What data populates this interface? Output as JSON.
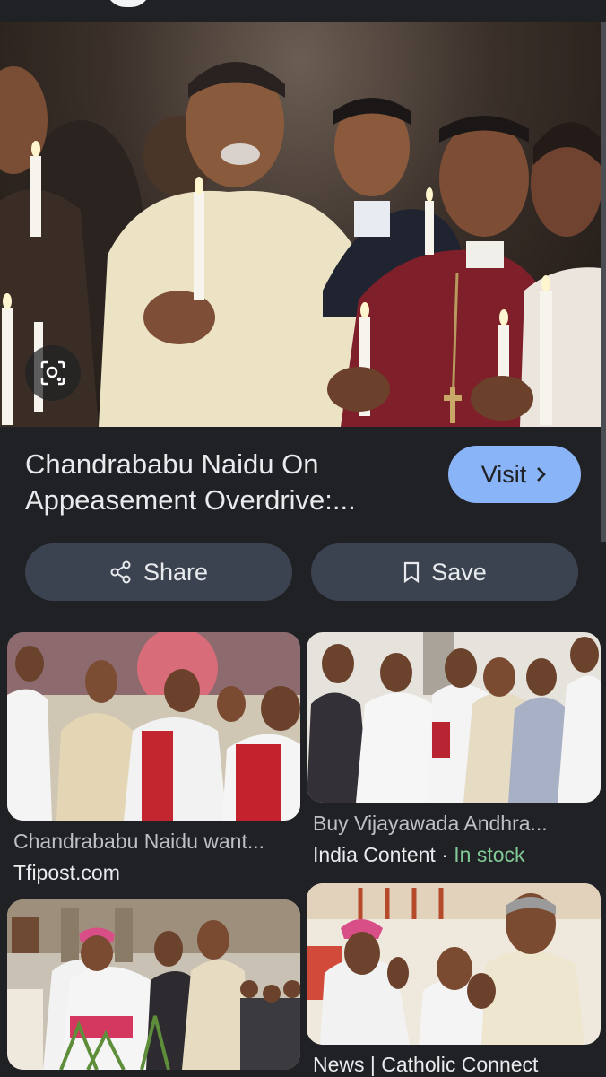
{
  "result": {
    "title": "Chandrababu Naidu On Appeasement Overdrive:...",
    "visit_label": "Visit",
    "share_label": "Share",
    "save_label": "Save"
  },
  "related": [
    {
      "caption": "Chandrababu Naidu want...",
      "source": "Tfipost.com"
    },
    {
      "caption": "Buy Vijayawada Andhra...",
      "source": "India Content",
      "separator": " · ",
      "status": "In stock"
    },
    {
      "caption": "",
      "source": ""
    },
    {
      "caption": "News | Catholic Connect",
      "source": ""
    }
  ],
  "colors": {
    "background": "#202124",
    "visit_button": "#8ab4f8",
    "pill_button": "#3c4350",
    "in_stock": "#81c995"
  },
  "icons": [
    "lens-search-icon",
    "chevron-right-icon",
    "share-icon",
    "bookmark-icon"
  ]
}
